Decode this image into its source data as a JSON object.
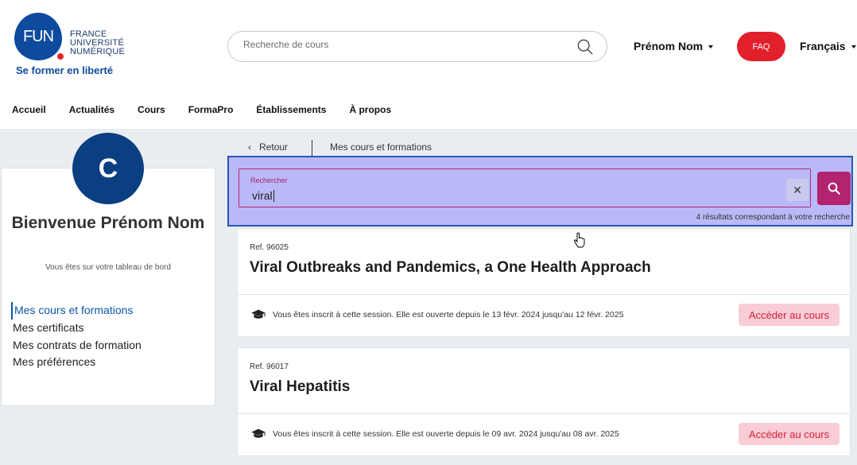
{
  "header": {
    "logo": {
      "mark": "FUN",
      "words": [
        "FRANCE",
        "UNIVERSITÉ",
        "NUMÉRIQUE"
      ],
      "tagline": "Se former en liberté"
    },
    "search": {
      "placeholder": "Recherche de cours",
      "icon": "search-icon"
    },
    "user_name": "Prénom Nom",
    "faq_label": "FAQ",
    "language": "Français"
  },
  "nav": {
    "items": [
      {
        "label": "Accueil"
      },
      {
        "label": "Actualités"
      },
      {
        "label": "Cours"
      },
      {
        "label": "FormaPro"
      },
      {
        "label": "Établissements"
      },
      {
        "label": "À propos"
      }
    ]
  },
  "sidebar": {
    "avatar_letter": "C",
    "welcome": "Bienvenue Prénom Nom",
    "subtitle": "Vous êtes sur votre tableau de bord",
    "links": [
      {
        "label": "Mes cours et formations",
        "active": true
      },
      {
        "label": "Mes certificats",
        "active": false
      },
      {
        "label": "Mes contrats de formation",
        "active": false
      },
      {
        "label": "Mes préférences",
        "active": false
      }
    ]
  },
  "breadcrumb": {
    "back_label": "Retour",
    "current": "Mes cours et formations"
  },
  "course_search": {
    "label": "Rechercher",
    "value": "viral",
    "result_count": "4 résultats correspondant à votre recherche"
  },
  "courses": [
    {
      "ref": "Ref. 96025",
      "title": "Viral Outbreaks and Pandemics, a One Health Approach",
      "session": "Vous êtes inscrit à cette session. Elle est ouverte depuis le 13 févr. 2024 jusqu'au 12 févr. 2025",
      "action": "Accéder au cours"
    },
    {
      "ref": "Ref. 96017",
      "title": "Viral Hepatitis",
      "session": "Vous êtes inscrit à cette session. Elle est ouverte depuis le 09 avr. 2024 jusqu'au 08 avr. 2025",
      "action": "Accéder au cours"
    }
  ],
  "colors": {
    "brand_blue": "#0e4a9e",
    "faq_red": "#e1202c",
    "accent_magenta": "#b3236f",
    "highlight": "#b9b9f7"
  }
}
